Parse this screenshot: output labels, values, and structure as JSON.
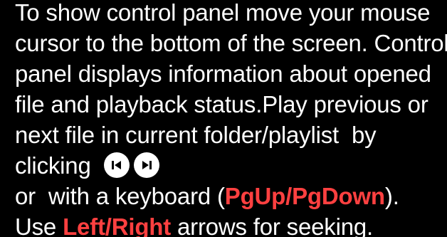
{
  "help": {
    "lines": [
      "To show control panel move your mouse",
      "cursor to the bottom of the screen. Control",
      "panel displays information about opened",
      "file and playback status.Play previous or",
      "next file in current folder/playlist  by"
    ],
    "clicking": "clicking",
    "keyboard_prefix": "or  with a keyboard (",
    "keyboard_keys": "PgUp/PgDown",
    "keyboard_suffix": ").",
    "seek_prefix": "Use ",
    "seek_keys": "Left/Right",
    "seek_suffix": " arrows for seeking."
  },
  "buttons": {
    "previous_icon": "skip-previous-icon",
    "next_icon": "skip-next-icon"
  },
  "colors": {
    "background": "#000000",
    "text": "#ffffff",
    "highlight": "#ff4040",
    "button": "#ffffff",
    "button_glyph": "#000000"
  }
}
